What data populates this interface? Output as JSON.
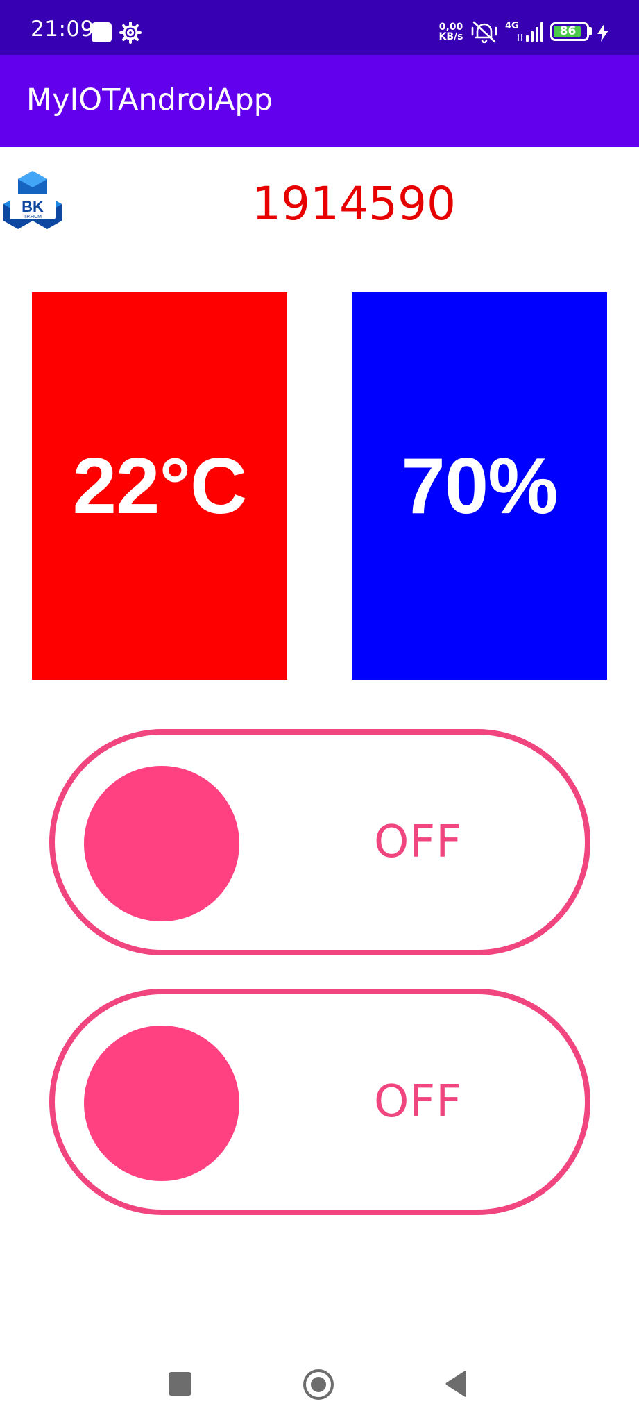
{
  "status_bar": {
    "time": "21:09",
    "speed_value": "0,00",
    "speed_unit": "KB/s",
    "network": "4G",
    "battery": "86",
    "icons": [
      "notification-square-icon",
      "settings-gear-icon",
      "vibrate-mute-icon",
      "signal-icon",
      "battery-icon",
      "charging-bolt-icon"
    ]
  },
  "app_bar": {
    "title": "MyIOTAndroiApp"
  },
  "header": {
    "logo_text": "BK",
    "logo_subtext": "TP.HCM",
    "student_id": "1914590"
  },
  "readings": {
    "temperature": "22°C",
    "humidity": "70%",
    "temperature_color": "#ff0000",
    "humidity_color": "#0000ff"
  },
  "switches": [
    {
      "label": "OFF",
      "state": "off"
    },
    {
      "label": "OFF",
      "state": "off"
    }
  ],
  "colors": {
    "status_bar": "#3700B3",
    "app_bar": "#6200EE",
    "accent": "#ff4081",
    "student_id": "#e60000"
  },
  "nav_bar": {
    "icons": [
      "recent-apps-icon",
      "home-icon",
      "back-icon"
    ]
  }
}
